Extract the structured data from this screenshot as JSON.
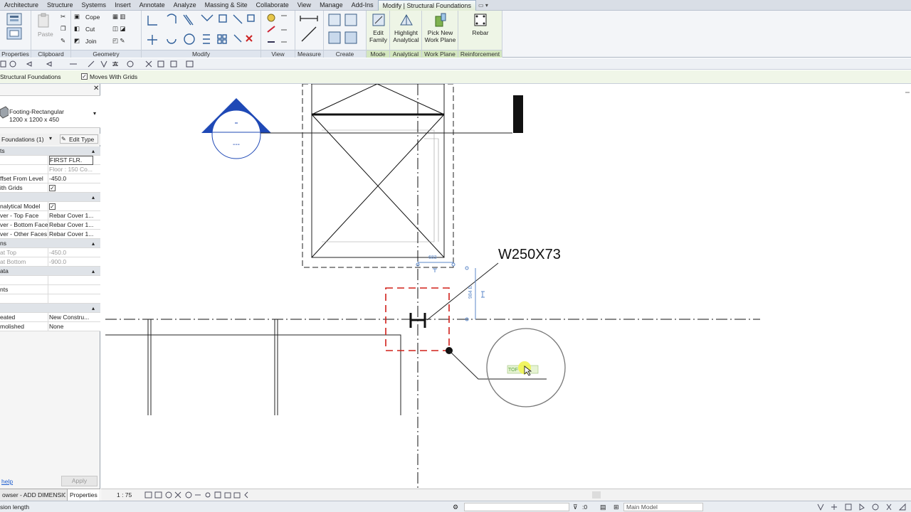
{
  "ribbon_tabs": [
    "Architecture",
    "Structure",
    "Systems",
    "Insert",
    "Annotate",
    "Analyze",
    "Massing & Site",
    "Collaborate",
    "View",
    "Manage",
    "Add-Ins",
    "Modify | Structural Foundations"
  ],
  "ribbon": {
    "panels": {
      "properties": "Properties",
      "clipboard": "Clipboard",
      "geometry": "Geometry",
      "modify": "Modify",
      "view": "View",
      "measure": "Measure",
      "create": "Create",
      "mode": "Mode",
      "analytical": "Analytical",
      "work_plane": "Work Plane",
      "reinforcement": "Reinforcement"
    },
    "clipboard": {
      "paste": "Paste"
    },
    "geometry": {
      "cope": "Cope",
      "cut": "Cut",
      "join": "Join"
    },
    "big_buttons": {
      "edit_family_1": "Edit",
      "edit_family_2": "Family",
      "highlight_1": "Highlight",
      "highlight_2": "Analytical",
      "pick_plane_1": "Pick New",
      "pick_plane_2": "Work Plane",
      "rebar": "Rebar"
    }
  },
  "options_bar": {
    "context": "Structural Foundations",
    "moves_with_grids": "Moves With Grids"
  },
  "properties": {
    "type_name_1": "Footing-Rectangular",
    "type_name_2": "1200 x 1200 x 450",
    "filter": "Foundations (1)",
    "edit_type": "Edit Type",
    "rows": [
      {
        "k": "ts",
        "v": "",
        "hdr": true
      },
      {
        "k": "",
        "v": "FIRST FLR."
      },
      {
        "k": "",
        "v": "Floor : 150 Co...",
        "grey": true
      },
      {
        "k": "ffset From Level",
        "v": "-450.0"
      },
      {
        "k": "ith Grids",
        "v": "",
        "chk": true
      },
      {
        "k": "",
        "v": "",
        "hdr": true
      },
      {
        "k": "nalytical Model",
        "v": "",
        "chk": true
      },
      {
        "k": "ver - Top Face",
        "v": "Rebar Cover 1..."
      },
      {
        "k": "ver - Bottom Face",
        "v": "Rebar Cover 1..."
      },
      {
        "k": "ver - Other Faces",
        "v": "Rebar Cover 1..."
      },
      {
        "k": "ns",
        "v": "",
        "hdr": true
      },
      {
        "k": "at Top",
        "v": "-450.0",
        "grey": true
      },
      {
        "k": "at Bottom",
        "v": "-900.0",
        "grey": true
      },
      {
        "k": "ata",
        "v": "",
        "hdr": true
      },
      {
        "k": "",
        "v": ""
      },
      {
        "k": "nts",
        "v": ""
      },
      {
        "k": "",
        "v": ""
      },
      {
        "k": "",
        "v": "",
        "hdr": true
      },
      {
        "k": "eated",
        "v": "New Constru..."
      },
      {
        "k": "molished",
        "v": "None"
      }
    ],
    "help": "help",
    "apply": "Apply",
    "tab_browser": "owser - ADD DIMENSIO...",
    "tab_properties": "Properties"
  },
  "canvas": {
    "beam_tag": "W250X73",
    "dim_top": "683",
    "dim_side": "984 E",
    "tag_small": "TOF",
    "grid_bubble_text": "---"
  },
  "view_bar": {
    "scale": "1 : 75"
  },
  "status_bar": {
    "message": "sion length",
    "selection_count": ":0",
    "workset": "Main Model"
  },
  "colors": {
    "accent_green": "#d3e6bf",
    "selection_red": "#d0201a",
    "dim_blue": "#5b87c8",
    "grid_blue": "#1f49b6"
  }
}
